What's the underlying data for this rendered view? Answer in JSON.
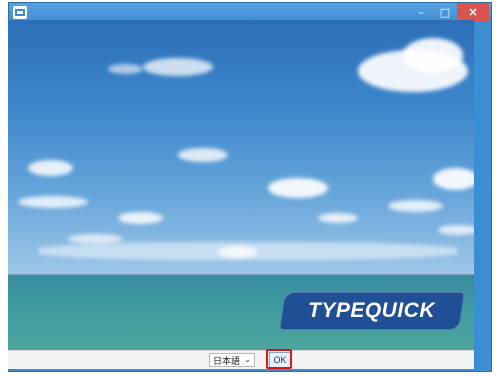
{
  "window": {
    "minimize_glyph": "–",
    "maximize_glyph": "□",
    "close_glyph": "×"
  },
  "brand": {
    "name": "TYPEQUICK"
  },
  "footer": {
    "language_selected": "日本語",
    "language_chevron": "⌄",
    "ok_label": "OK"
  },
  "colors": {
    "titlebar": "#3f8bd0",
    "close": "#d9534f",
    "badge": "#1f4f94",
    "highlight": "#e0141b"
  },
  "icons": {
    "app": "app-icon",
    "minimize": "minimize-icon",
    "maximize": "maximize-icon",
    "close": "close-icon"
  }
}
